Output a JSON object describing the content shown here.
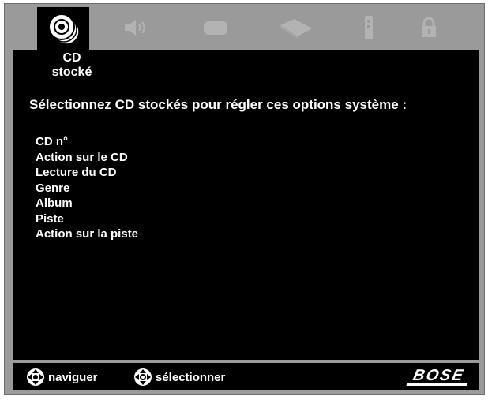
{
  "tabs": [
    {
      "name": "cd-stored",
      "icon": "stored-cd-icon",
      "active": true
    },
    {
      "name": "audio",
      "icon": "speaker-icon",
      "active": false
    },
    {
      "name": "video",
      "icon": "tv-icon",
      "active": false
    },
    {
      "name": "source",
      "icon": "media-player-icon",
      "active": false
    },
    {
      "name": "remote",
      "icon": "remote-icon",
      "active": false
    },
    {
      "name": "lock",
      "icon": "lock-icon",
      "active": false
    }
  ],
  "screen": {
    "tab_label_line1": "CD",
    "tab_label_line2": "stocké",
    "heading": "Sélectionnez CD stockés pour régler ces options système :",
    "options": [
      "CD n°",
      "Action sur le CD",
      "Lecture du CD",
      "Genre",
      "Album",
      "Piste",
      "Action sur la piste"
    ]
  },
  "footer": {
    "navigate_label": "naviguer",
    "select_label": "sélectionner",
    "brand": "BOSE"
  },
  "colors": {
    "frame": "#9a9a9a",
    "screen": "#000000",
    "text": "#ffffff",
    "inactive_icon": "#b3b3b3"
  }
}
